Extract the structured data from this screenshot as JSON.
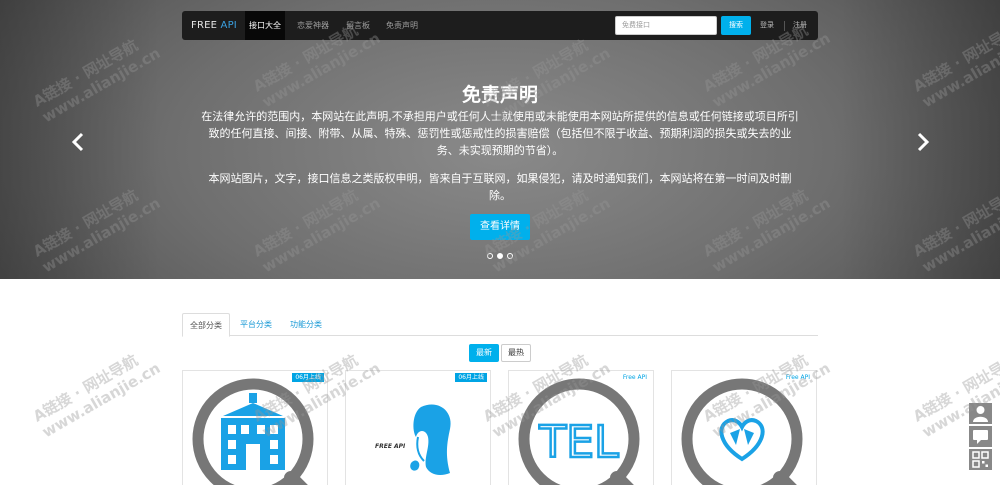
{
  "navbar": {
    "brand_prefix": "FREE",
    "brand_suffix": "API",
    "items": [
      {
        "label": "接口大全",
        "active": true
      },
      {
        "label": "恋爱神器",
        "active": false
      },
      {
        "label": "留言板",
        "active": false
      },
      {
        "label": "免责声明",
        "active": false
      }
    ],
    "search_placeholder": "免费接口",
    "search_button": "搜索",
    "login": "登录",
    "register": "注册"
  },
  "hero": {
    "title": "免责声明",
    "paragraph1": "在法律允许的范围内，本网站在此声明,不承担用户或任何人士就使用或未能使用本网站所提供的信息或任何链接或项目所引致的任何直接、间接、附带、从属、特殊、惩罚性或惩戒性的损害赔偿（包括但不限于收益、预期利润的损失或失去的业务、未实现预期的节省）。",
    "paragraph2": "本网站图片，文字，接口信息之类版权申明，皆来自于互联网，如果侵犯，请及时通知我们，本网站将在第一时间及时删除。",
    "button": "查看详情",
    "slides_total": 3,
    "slide_active": 2
  },
  "tabs": [
    {
      "label": "全部分类",
      "active": true
    },
    {
      "label": "平台分类",
      "active": false
    },
    {
      "label": "功能分类",
      "active": false
    }
  ],
  "filters": [
    {
      "label": "最新",
      "active": true
    },
    {
      "label": "最热",
      "active": false
    }
  ],
  "cards": [
    {
      "badge": "06月上线",
      "badge_style": "solid",
      "icon": "school-building-icon"
    },
    {
      "badge": "06月上线",
      "badge_style": "solid",
      "icon": "woman-portrait-icon",
      "art_text": "FREE API"
    },
    {
      "badge": "Free API",
      "badge_style": "plain",
      "icon": "tel-icon",
      "art_text": "TEL"
    },
    {
      "badge": "Free API",
      "badge_style": "plain",
      "icon": "hearts-logo-icon"
    }
  ],
  "side_tools": [
    "user-icon",
    "chat-icon",
    "qrcode-icon"
  ],
  "watermark": {
    "line1": "A链接 · 网址导航",
    "line2": "www.alianjie.cn"
  },
  "colors": {
    "accent": "#00b0ec",
    "navbar": "#1d1d1d",
    "art_gray": "#777777"
  }
}
